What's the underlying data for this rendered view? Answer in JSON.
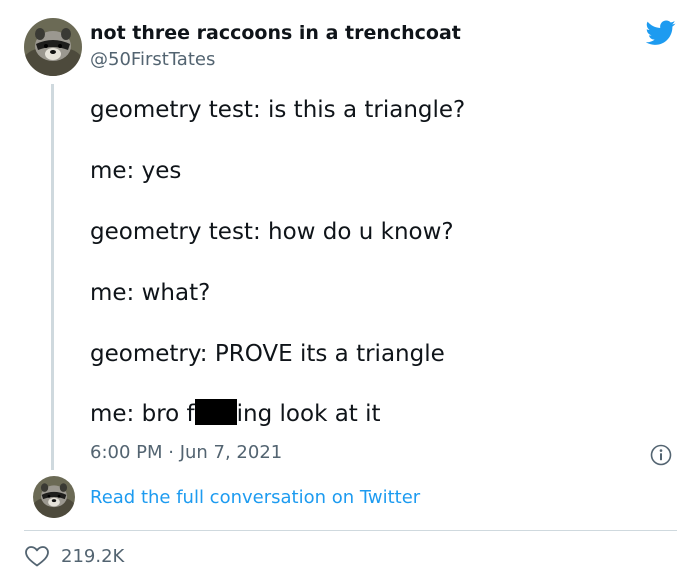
{
  "author": {
    "display_name": "not three raccoons in a trenchcoat",
    "handle": "@50FirstTates"
  },
  "tweet": {
    "lines": [
      "geometry test: is this a triangle?",
      "me: yes",
      "geometry test: how do u know?",
      "me: what?",
      "geometry: PROVE its a triangle"
    ],
    "last_line_before": "me: bro f",
    "last_line_after": "ing look at it",
    "timestamp": "6:00 PM · Jun 7, 2021"
  },
  "conversation_link": "Read the full conversation on Twitter",
  "engagement": {
    "likes": "219.2K"
  },
  "icons": {
    "brand": "twitter-bird-icon",
    "info": "info-icon",
    "like": "heart-icon"
  },
  "colors": {
    "brand": "#1d9bf0",
    "text": "#0f1419",
    "secondary_text": "#536471",
    "divider": "#cfd9de"
  }
}
